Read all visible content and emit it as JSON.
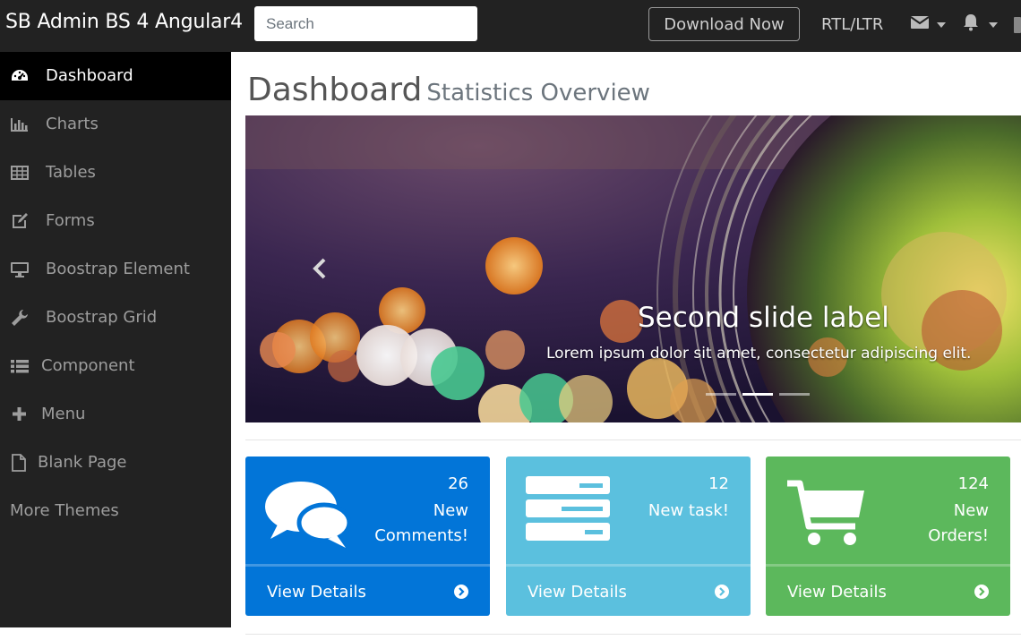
{
  "navbar": {
    "brand": "SB Admin BS 4 Angular4",
    "search_placeholder": "Search",
    "download_label": "Download Now",
    "rtl_label": "RTL/LTR",
    "icons": [
      "envelope-icon",
      "bell-icon"
    ]
  },
  "sidebar": {
    "items": [
      {
        "label": "Dashboard",
        "icon": "dashboard-icon",
        "active": true
      },
      {
        "label": "Charts",
        "icon": "bar-chart-icon"
      },
      {
        "label": "Tables",
        "icon": "table-icon"
      },
      {
        "label": "Forms",
        "icon": "edit-icon"
      },
      {
        "label": "Boostrap Element",
        "icon": "desktop-icon"
      },
      {
        "label": "Boostrap Grid",
        "icon": "wrench-icon"
      },
      {
        "label": "Component",
        "icon": "list-icon"
      },
      {
        "label": "Menu",
        "icon": "plus-icon"
      },
      {
        "label": "Blank Page",
        "icon": "file-icon"
      },
      {
        "label": "More Themes",
        "icon": ""
      }
    ]
  },
  "header": {
    "title": "Dashboard",
    "subtitle": "Statistics Overview"
  },
  "carousel": {
    "slide_title": "Second slide label",
    "slide_text": "Lorem ipsum dolor sit amet, consectetur adipiscing elit.",
    "active_indicator": 2,
    "indicator_count": 3
  },
  "cards": [
    {
      "count": "26",
      "line1": "New",
      "line2": "Comments!",
      "link": "View Details",
      "color": "#0275d8",
      "icon": "comments-icon"
    },
    {
      "count": "12",
      "line1": "New task!",
      "line2": "",
      "link": "View Details",
      "color": "#5bc0de",
      "icon": "tasks-icon"
    },
    {
      "count": "124",
      "line1": "New",
      "line2": "Orders!",
      "link": "View Details",
      "color": "#5cb85c",
      "icon": "shopping-cart-icon"
    }
  ],
  "colors": {
    "navbar_bg": "#222222",
    "sidebar_active_bg": "#000000",
    "primary": "#0275d8",
    "info": "#5bc0de",
    "success": "#5cb85c"
  }
}
